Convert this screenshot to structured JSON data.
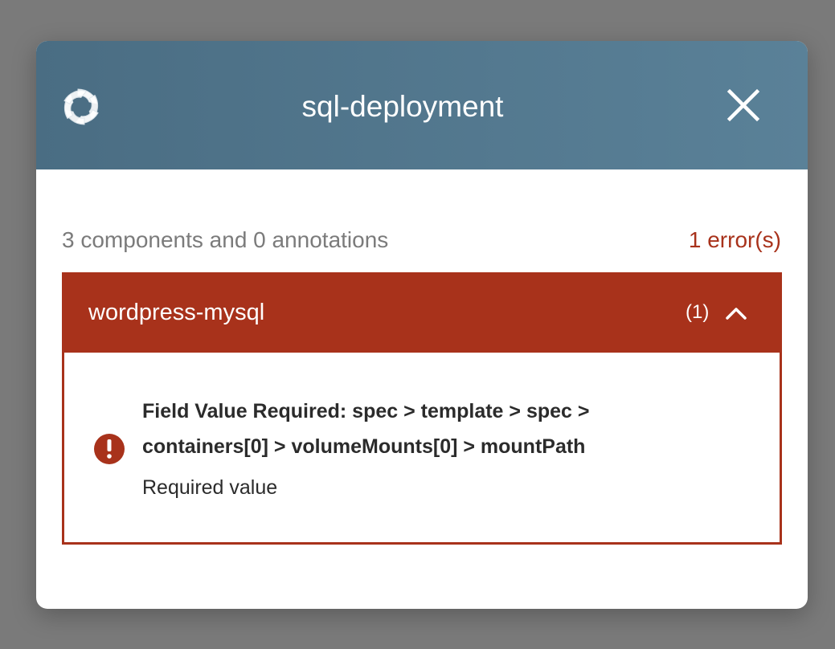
{
  "dialog": {
    "title": "sql-deployment",
    "logo_icon": "helm-wheel-icon",
    "close_icon": "close-icon"
  },
  "summary": {
    "text": "3 components and 0 annotations",
    "errors": "1 error(s)"
  },
  "panel": {
    "name": "wordpress-mysql",
    "count": "(1)",
    "toggle_icon": "chevron-up-icon",
    "error": {
      "icon": "exclamation-circle-icon",
      "title": "Field Value Required: spec > template > spec > containers[0] > volumeMounts[0] > mountPath",
      "description": "Required value"
    }
  },
  "colors": {
    "header_bg": "#4a6d83",
    "error": "#a8321b",
    "backdrop": "#7a7a7a"
  }
}
